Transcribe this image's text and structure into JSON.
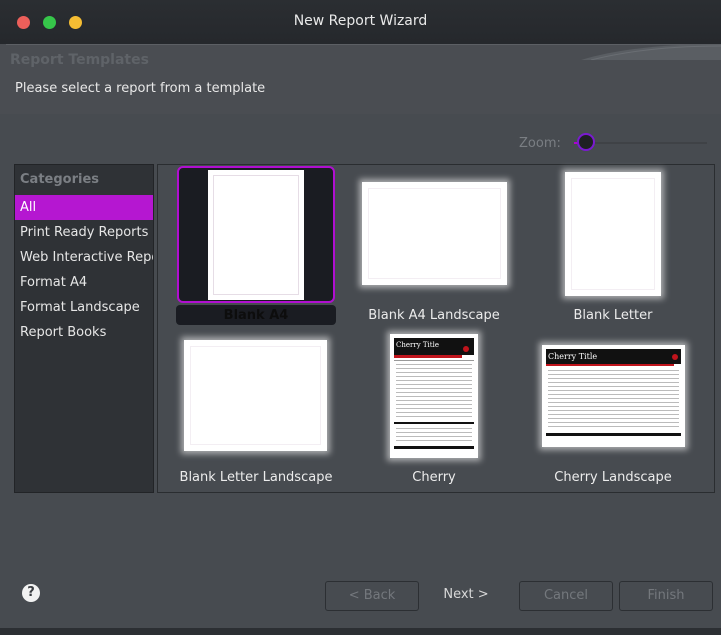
{
  "window": {
    "title": "New Report Wizard",
    "traffic_lights": [
      "close-button",
      "minimize-button",
      "zoom-button"
    ]
  },
  "banner": {
    "title": "Report Templates",
    "description": "Please select a report from a template"
  },
  "zoom": {
    "label": "Zoom:",
    "level": 0.0
  },
  "categories": {
    "header": "Categories",
    "items": [
      {
        "label": "All",
        "selected": true
      },
      {
        "label": "Print Ready Reports",
        "selected": false
      },
      {
        "label": "Web Interactive Reports",
        "selected": false
      },
      {
        "label": "Format A4",
        "selected": false
      },
      {
        "label": "Format Landscape",
        "selected": false
      },
      {
        "label": "Report Books",
        "selected": false
      }
    ]
  },
  "templates": [
    {
      "label": "Blank A4",
      "selected": true
    },
    {
      "label": "Blank A4 Landscape",
      "selected": false
    },
    {
      "label": "Blank Letter",
      "selected": false
    },
    {
      "label": "Blank Letter Landscape",
      "selected": false
    },
    {
      "label": "Cherry",
      "selected": false,
      "preview_title": "Cherry Title"
    },
    {
      "label": "Cherry Landscape",
      "selected": false,
      "preview_title": "Cherry Title"
    }
  ],
  "buttons": {
    "help_icon": "question-mark",
    "back": "< Back",
    "next": "Next >",
    "cancel": "Cancel",
    "finish": "Finish"
  },
  "colors": {
    "accent": "#b517d1",
    "background": "#474b50",
    "panel": "#2f3236"
  }
}
